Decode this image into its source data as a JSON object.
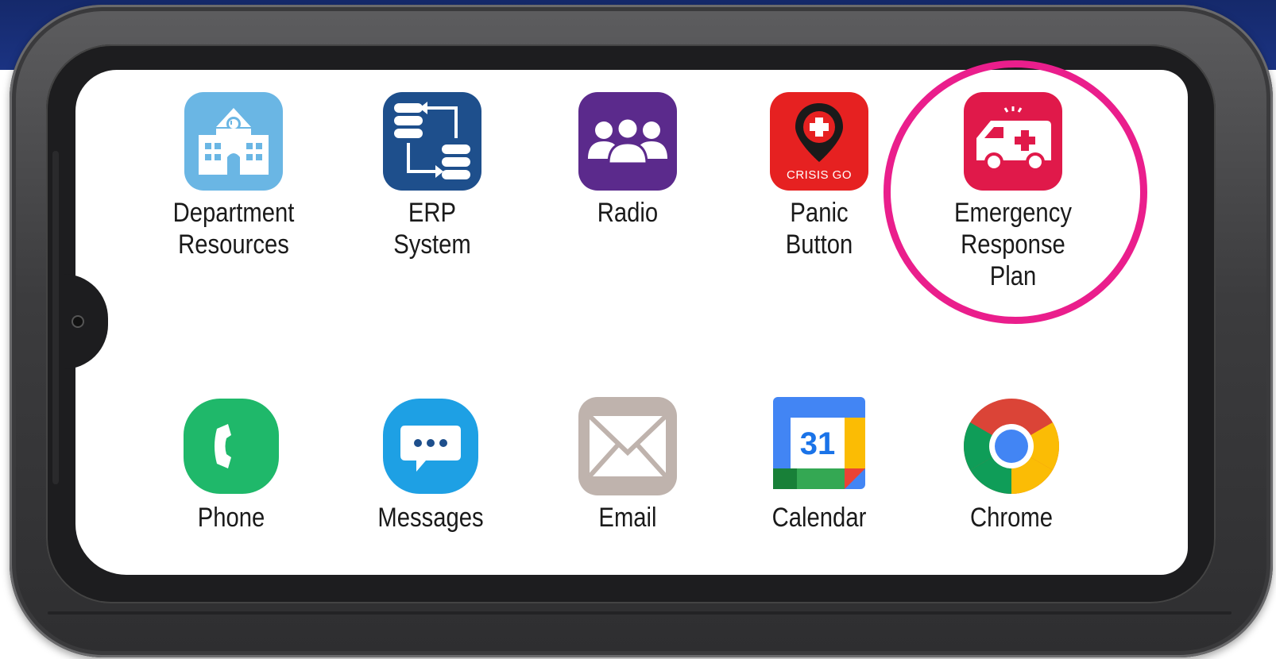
{
  "apps_row1": [
    {
      "label": "Department\nResources",
      "icon": "school-building-icon"
    },
    {
      "label": "ERP\nSystem",
      "icon": "database-sync-icon"
    },
    {
      "label": "Radio",
      "icon": "people-group-icon"
    },
    {
      "label": "Panic\nButton",
      "icon": "crisisgo-pin-icon",
      "icon_text": "CRISIS GO"
    },
    {
      "label": "Emergency\nResponse\nPlan",
      "icon": "ambulance-icon"
    }
  ],
  "apps_row2": [
    {
      "label": "Phone",
      "icon": "phone-icon"
    },
    {
      "label": "Messages",
      "icon": "chat-bubble-icon"
    },
    {
      "label": "Email",
      "icon": "envelope-icon"
    },
    {
      "label": "Calendar",
      "icon": "calendar-icon",
      "icon_text": "31"
    },
    {
      "label": "Chrome",
      "icon": "chrome-icon"
    }
  ],
  "highlight_color": "#ea1e8c",
  "banner_color": "#1b3382"
}
